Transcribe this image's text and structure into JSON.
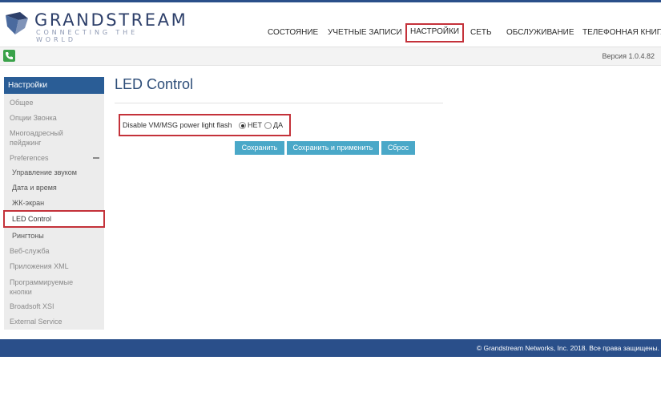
{
  "brand": {
    "name": "GRANDSTREAM",
    "tagline": "CONNECTING THE WORLD"
  },
  "nav": {
    "items": [
      {
        "label": "СОСТОЯНИЕ"
      },
      {
        "label": "УЧЕТНЫЕ ЗАПИСИ"
      },
      {
        "label": "НАСТРОЙКИ",
        "active": true
      },
      {
        "label": "СЕТЬ"
      },
      {
        "label": "ОБСЛУЖИВАНИЕ"
      },
      {
        "label": "ТЕЛЕФОННАЯ КНИГА"
      }
    ]
  },
  "toolbar": {
    "version": "Версия 1.0.4.82"
  },
  "sidebar": {
    "header": "Настройки",
    "items": [
      {
        "label": "Общее"
      },
      {
        "label": "Опции Звонка"
      },
      {
        "label": "Многоадресный пейджинг"
      },
      {
        "label": "Preferences",
        "expanded": true
      },
      {
        "label": "Управление звуком",
        "sub": true
      },
      {
        "label": "Дата и время",
        "sub": true
      },
      {
        "label": "ЖК-экран",
        "sub": true
      },
      {
        "label": "LED Control",
        "sub": true,
        "active": true
      },
      {
        "label": "Рингтоны",
        "sub": true
      },
      {
        "label": "Веб-служба"
      },
      {
        "label": "Приложения XML"
      },
      {
        "label": "Программируемые кнопки"
      },
      {
        "label": "Broadsoft XSI"
      },
      {
        "label": "External Service"
      }
    ]
  },
  "main": {
    "title": "LED Control",
    "option": {
      "label": "Disable VM/MSG power light flash",
      "choices": [
        {
          "label": "НЕТ",
          "checked": true
        },
        {
          "label": "ДА",
          "checked": false
        }
      ]
    },
    "buttons": {
      "save": "Сохранить",
      "save_apply": "Сохранить и применить",
      "reset": "Сброс"
    }
  },
  "footer": {
    "copyright": "© Grandstream Networks, Inc. 2018. Все права защищены."
  },
  "colors": {
    "brand_blue": "#2a4f8a",
    "sidebar_header": "#2a5d96",
    "highlight_red": "#c4323a",
    "button": "#4aa8c8",
    "phone_green": "#3aa24a"
  }
}
